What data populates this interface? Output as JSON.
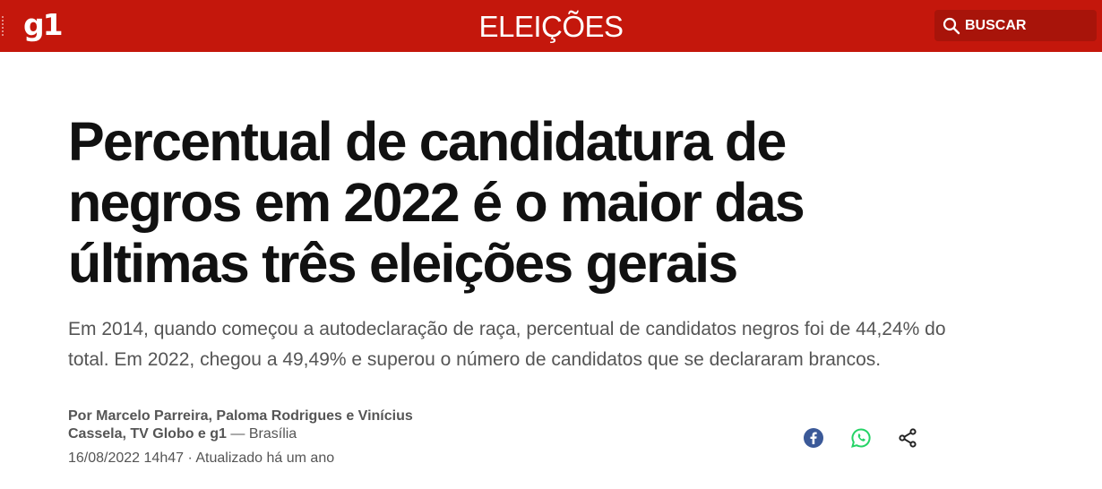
{
  "header": {
    "logo": "g1",
    "section": "ELEIÇÕES",
    "search_label": "BUSCAR",
    "brand_color": "#c4170c"
  },
  "article": {
    "headline": "Percentual de candidatura de negros em 2022 é o maior das últimas três eleições gerais",
    "subtitle": "Em 2014, quando começou a autodeclaração de raça, percentual de candidatos negros foi de 44,24% do total. Em 2022, chegou a 49,49% e superou o número de candidatos que se declararam brancos.",
    "authors": "Por Marcelo Parreira, Paloma Rodrigues e Vinícius Cassela, TV Globo e g1",
    "location": " — Brasília",
    "published": "16/08/2022 14h47 · Atualizado há um ano"
  },
  "share": {
    "icons": [
      "facebook-icon",
      "whatsapp-icon",
      "share-icon"
    ],
    "facebook_color": "#3b5998",
    "whatsapp_color": "#25d366"
  }
}
